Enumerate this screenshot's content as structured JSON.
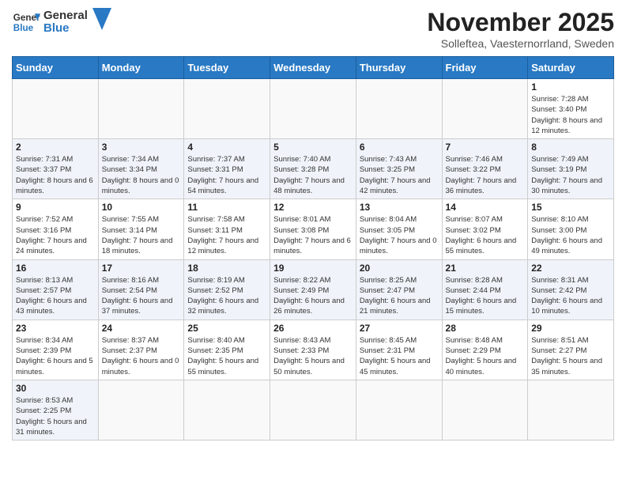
{
  "header": {
    "logo_general": "General",
    "logo_blue": "Blue",
    "month_title": "November 2025",
    "subtitle": "Solleftea, Vaesternorrland, Sweden"
  },
  "weekdays": [
    "Sunday",
    "Monday",
    "Tuesday",
    "Wednesday",
    "Thursday",
    "Friday",
    "Saturday"
  ],
  "weeks": [
    [
      {
        "day": "",
        "info": ""
      },
      {
        "day": "",
        "info": ""
      },
      {
        "day": "",
        "info": ""
      },
      {
        "day": "",
        "info": ""
      },
      {
        "day": "",
        "info": ""
      },
      {
        "day": "",
        "info": ""
      },
      {
        "day": "1",
        "info": "Sunrise: 7:28 AM\nSunset: 3:40 PM\nDaylight: 8 hours and 12 minutes."
      }
    ],
    [
      {
        "day": "2",
        "info": "Sunrise: 7:31 AM\nSunset: 3:37 PM\nDaylight: 8 hours and 6 minutes."
      },
      {
        "day": "3",
        "info": "Sunrise: 7:34 AM\nSunset: 3:34 PM\nDaylight: 8 hours and 0 minutes."
      },
      {
        "day": "4",
        "info": "Sunrise: 7:37 AM\nSunset: 3:31 PM\nDaylight: 7 hours and 54 minutes."
      },
      {
        "day": "5",
        "info": "Sunrise: 7:40 AM\nSunset: 3:28 PM\nDaylight: 7 hours and 48 minutes."
      },
      {
        "day": "6",
        "info": "Sunrise: 7:43 AM\nSunset: 3:25 PM\nDaylight: 7 hours and 42 minutes."
      },
      {
        "day": "7",
        "info": "Sunrise: 7:46 AM\nSunset: 3:22 PM\nDaylight: 7 hours and 36 minutes."
      },
      {
        "day": "8",
        "info": "Sunrise: 7:49 AM\nSunset: 3:19 PM\nDaylight: 7 hours and 30 minutes."
      }
    ],
    [
      {
        "day": "9",
        "info": "Sunrise: 7:52 AM\nSunset: 3:16 PM\nDaylight: 7 hours and 24 minutes."
      },
      {
        "day": "10",
        "info": "Sunrise: 7:55 AM\nSunset: 3:14 PM\nDaylight: 7 hours and 18 minutes."
      },
      {
        "day": "11",
        "info": "Sunrise: 7:58 AM\nSunset: 3:11 PM\nDaylight: 7 hours and 12 minutes."
      },
      {
        "day": "12",
        "info": "Sunrise: 8:01 AM\nSunset: 3:08 PM\nDaylight: 7 hours and 6 minutes."
      },
      {
        "day": "13",
        "info": "Sunrise: 8:04 AM\nSunset: 3:05 PM\nDaylight: 7 hours and 0 minutes."
      },
      {
        "day": "14",
        "info": "Sunrise: 8:07 AM\nSunset: 3:02 PM\nDaylight: 6 hours and 55 minutes."
      },
      {
        "day": "15",
        "info": "Sunrise: 8:10 AM\nSunset: 3:00 PM\nDaylight: 6 hours and 49 minutes."
      }
    ],
    [
      {
        "day": "16",
        "info": "Sunrise: 8:13 AM\nSunset: 2:57 PM\nDaylight: 6 hours and 43 minutes."
      },
      {
        "day": "17",
        "info": "Sunrise: 8:16 AM\nSunset: 2:54 PM\nDaylight: 6 hours and 37 minutes."
      },
      {
        "day": "18",
        "info": "Sunrise: 8:19 AM\nSunset: 2:52 PM\nDaylight: 6 hours and 32 minutes."
      },
      {
        "day": "19",
        "info": "Sunrise: 8:22 AM\nSunset: 2:49 PM\nDaylight: 6 hours and 26 minutes."
      },
      {
        "day": "20",
        "info": "Sunrise: 8:25 AM\nSunset: 2:47 PM\nDaylight: 6 hours and 21 minutes."
      },
      {
        "day": "21",
        "info": "Sunrise: 8:28 AM\nSunset: 2:44 PM\nDaylight: 6 hours and 15 minutes."
      },
      {
        "day": "22",
        "info": "Sunrise: 8:31 AM\nSunset: 2:42 PM\nDaylight: 6 hours and 10 minutes."
      }
    ],
    [
      {
        "day": "23",
        "info": "Sunrise: 8:34 AM\nSunset: 2:39 PM\nDaylight: 6 hours and 5 minutes."
      },
      {
        "day": "24",
        "info": "Sunrise: 8:37 AM\nSunset: 2:37 PM\nDaylight: 6 hours and 0 minutes."
      },
      {
        "day": "25",
        "info": "Sunrise: 8:40 AM\nSunset: 2:35 PM\nDaylight: 5 hours and 55 minutes."
      },
      {
        "day": "26",
        "info": "Sunrise: 8:43 AM\nSunset: 2:33 PM\nDaylight: 5 hours and 50 minutes."
      },
      {
        "day": "27",
        "info": "Sunrise: 8:45 AM\nSunset: 2:31 PM\nDaylight: 5 hours and 45 minutes."
      },
      {
        "day": "28",
        "info": "Sunrise: 8:48 AM\nSunset: 2:29 PM\nDaylight: 5 hours and 40 minutes."
      },
      {
        "day": "29",
        "info": "Sunrise: 8:51 AM\nSunset: 2:27 PM\nDaylight: 5 hours and 35 minutes."
      }
    ],
    [
      {
        "day": "30",
        "info": "Sunrise: 8:53 AM\nSunset: 2:25 PM\nDaylight: 5 hours and 31 minutes."
      },
      {
        "day": "",
        "info": ""
      },
      {
        "day": "",
        "info": ""
      },
      {
        "day": "",
        "info": ""
      },
      {
        "day": "",
        "info": ""
      },
      {
        "day": "",
        "info": ""
      },
      {
        "day": "",
        "info": ""
      }
    ]
  ]
}
